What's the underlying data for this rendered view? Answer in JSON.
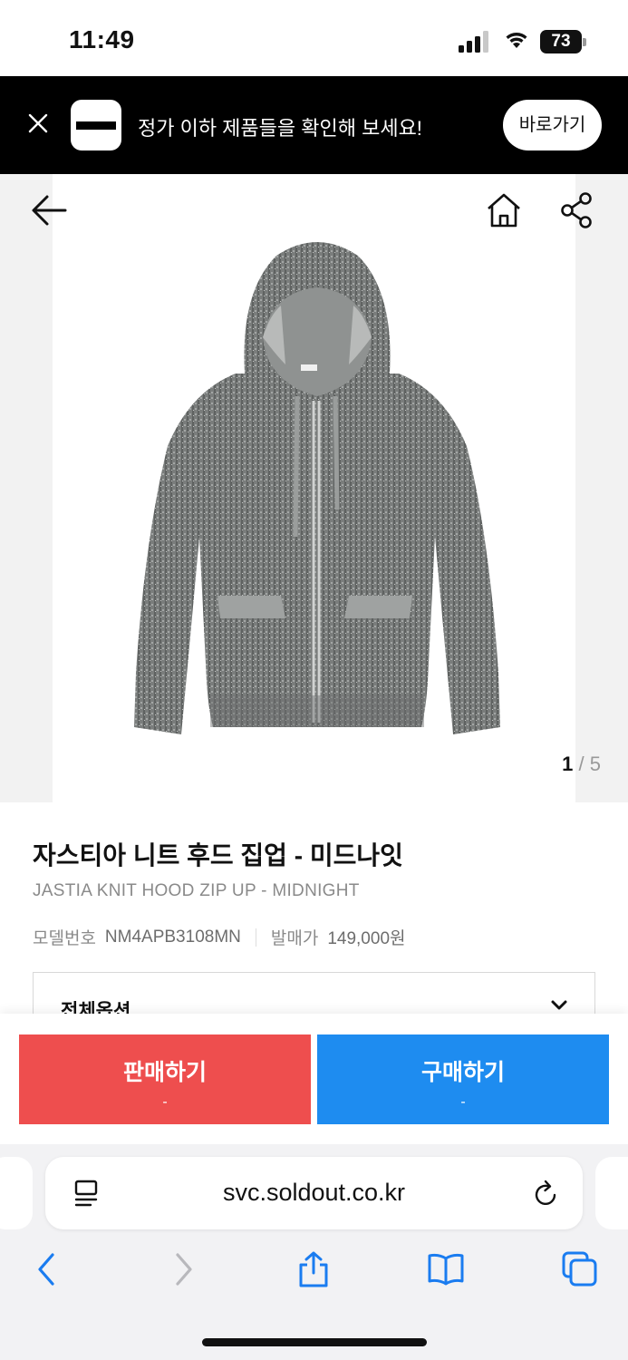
{
  "status_bar": {
    "time": "11:49",
    "battery": "73"
  },
  "promo": {
    "message": "정가 이하 제품들을 확인해 보세요!",
    "button_label": "바로가기"
  },
  "gallery": {
    "current": "1",
    "separator": "/",
    "total": "5"
  },
  "product": {
    "name_ko": "자스티아 니트 후드 집업 - 미드나잇",
    "name_en": "JASTIA KNIT HOOD ZIP UP - MIDNIGHT",
    "model_label": "모델번호",
    "model_value": "NM4APB3108MN",
    "release_label": "발매가",
    "release_price": "149,000원"
  },
  "options": {
    "label": "전체옵션"
  },
  "actions": {
    "sell_label": "판매하기",
    "sell_sub": "-",
    "buy_label": "구매하기",
    "buy_sub": "-"
  },
  "browser": {
    "url": "svc.soldout.co.kr"
  },
  "colors": {
    "sell": "#ee4e4e",
    "buy": "#1e8cf0",
    "link_blue": "#1a7cf0"
  }
}
